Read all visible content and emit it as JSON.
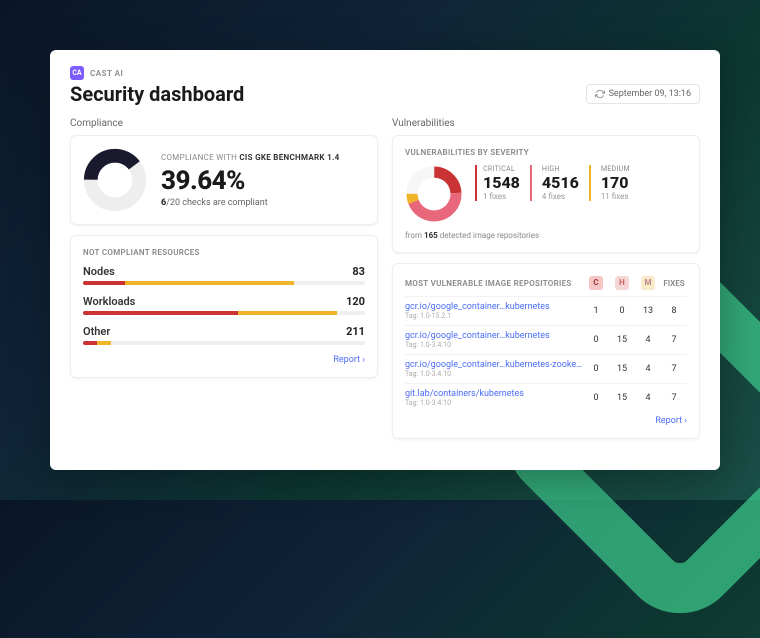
{
  "brand": "CAST AI",
  "logo_text": "CA",
  "title": "Security dashboard",
  "timestamp": "September 09, 13:16",
  "compliance": {
    "section_label": "Compliance",
    "heading_prefix": "COMPLIANCE WITH ",
    "heading_bold": "CIS GKE BENCHMARK 1.4",
    "percent": "39.64%",
    "checks_done": "6",
    "checks_total": "/20",
    "checks_suffix": " checks are compliant",
    "resources_heading": "NOT COMPLIANT RESOURCES",
    "resources": [
      {
        "name": "Nodes",
        "value": "83",
        "segs": [
          [
            "#c93333",
            15
          ],
          [
            "#f0b429",
            60
          ],
          [
            "#f0f0f0",
            25
          ]
        ]
      },
      {
        "name": "Workloads",
        "value": "120",
        "segs": [
          [
            "#c93333",
            55
          ],
          [
            "#f0b429",
            35
          ],
          [
            "#f0f0f0",
            10
          ]
        ]
      },
      {
        "name": "Other",
        "value": "211",
        "segs": [
          [
            "#c93333",
            5
          ],
          [
            "#f0b429",
            5
          ],
          [
            "#f0f0f0",
            90
          ]
        ]
      }
    ],
    "report_label": "Report ›"
  },
  "vulnerabilities": {
    "section_label": "Vulnerabilities",
    "heading": "VULNERABILITIES BY SEVERITY",
    "stats": [
      {
        "label": "CRITICAL",
        "value": "1548",
        "fixes": "1 fixes",
        "color": "#c93333"
      },
      {
        "label": "HIGH",
        "value": "4516",
        "fixes": "4 fixes",
        "color": "#e8677a"
      },
      {
        "label": "MEDIUM",
        "value": "170",
        "fixes": "11 fixes",
        "color": "#f0b429"
      }
    ],
    "note_prefix": "from ",
    "note_count": "165",
    "note_suffix": " detected image repositories",
    "table_heading": "MOST VULNERABLE IMAGE REPOSITORIES",
    "cols": [
      {
        "badge": "C",
        "bg": "#f5c6c6",
        "fg": "#a33"
      },
      {
        "badge": "H",
        "bg": "#f7d6d6",
        "fg": "#c66"
      },
      {
        "badge": "M",
        "bg": "#fae9c8",
        "fg": "#b88"
      }
    ],
    "fixes_col": "FIXES",
    "rows": [
      {
        "name": "gcr.io/google_container…kubernetes",
        "tag": "Tag: 1.0-15.2.1",
        "c": "1",
        "h": "0",
        "m": "13",
        "f": "8"
      },
      {
        "name": "gcr.io/google_container…kubernetes",
        "tag": "Tag: 1.0-3.4.10",
        "c": "0",
        "h": "15",
        "m": "4",
        "f": "7"
      },
      {
        "name": "gcr.io/google_container…kubernetes-zookeep…",
        "tag": "Tag: 1.0-3.4.10",
        "c": "0",
        "h": "15",
        "m": "4",
        "f": "7"
      },
      {
        "name": "git.lab/containers/kubernetes",
        "tag": "Tag: 1.0-3.4.10",
        "c": "0",
        "h": "15",
        "m": "4",
        "f": "7"
      }
    ],
    "report_label": "Report ›"
  }
}
